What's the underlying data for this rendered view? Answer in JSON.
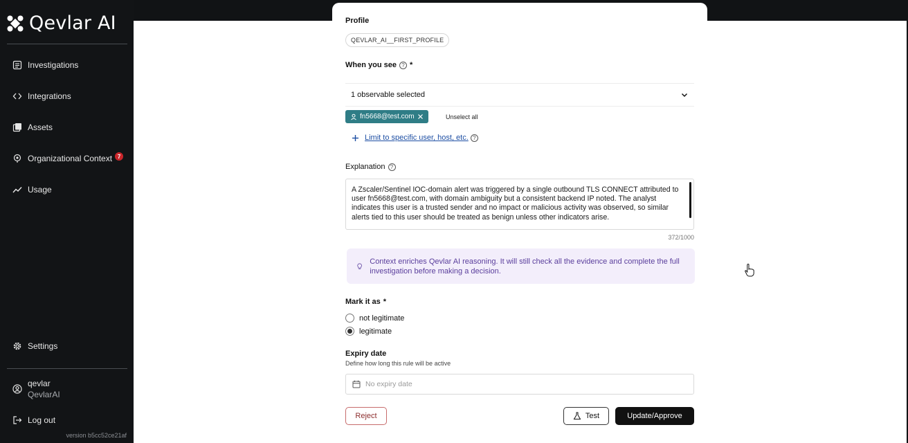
{
  "brand": {
    "name": "Qevlar AI"
  },
  "sidebar": {
    "items": [
      {
        "label": "Investigations",
        "icon": "list-icon"
      },
      {
        "label": "Integrations",
        "icon": "code-icon"
      },
      {
        "label": "Assets",
        "icon": "assets-icon"
      },
      {
        "label": "Organizational Context",
        "icon": "location-icon",
        "badge": "7"
      },
      {
        "label": "Usage",
        "icon": "trend-icon"
      }
    ],
    "settings_label": "Settings",
    "user": {
      "name": "qevlar",
      "org": "QevlarAI"
    },
    "logout_label": "Log out",
    "version": "version b5cc52ce21af"
  },
  "form": {
    "profile_label": "Profile",
    "profile_value": "QEVLAR_AI__FIRST_PROFILE",
    "when_label": "When you see",
    "required_mark": "*",
    "select_value": "1 observable selected",
    "tag_value": "fn5668@test.com",
    "unselect_label": "Unselect all",
    "limit_label": "Limit to specific user, host, etc.",
    "explanation_label": "Explanation",
    "explanation_text": "A Zscaler/Sentinel IOC-domain alert was triggered by a single outbound TLS CONNECT attributed to user fn5668@test.com, with domain ambiguity but a consistent backend IP noted. The analyst indicates this user is a trusted sender and no impact or malicious activity was observed, so similar alerts tied to this user should be treated as benign unless other indicators arise.",
    "counter": "372/1000",
    "info_text": "Context enriches Qevlar AI reasoning. It will still check all the evidence and complete the full investigation before making a decision.",
    "mark_label": "Mark it as",
    "options": [
      {
        "label": "not legitimate",
        "selected": false
      },
      {
        "label": "legitimate",
        "selected": true
      }
    ],
    "expiry_label": "Expiry date",
    "expiry_hint": "Define how long this rule will be active",
    "expiry_placeholder": "No expiry date",
    "reject_label": "Reject",
    "test_label": "Test",
    "approve_label": "Update/Approve"
  },
  "colors": {
    "sidebar_bg": "#121416",
    "tag_bg": "#2f7d86",
    "info_bg": "#f3eefb",
    "info_text": "#5a3e9c",
    "reject": "#8c2d2d",
    "badge": "#c9262b"
  }
}
